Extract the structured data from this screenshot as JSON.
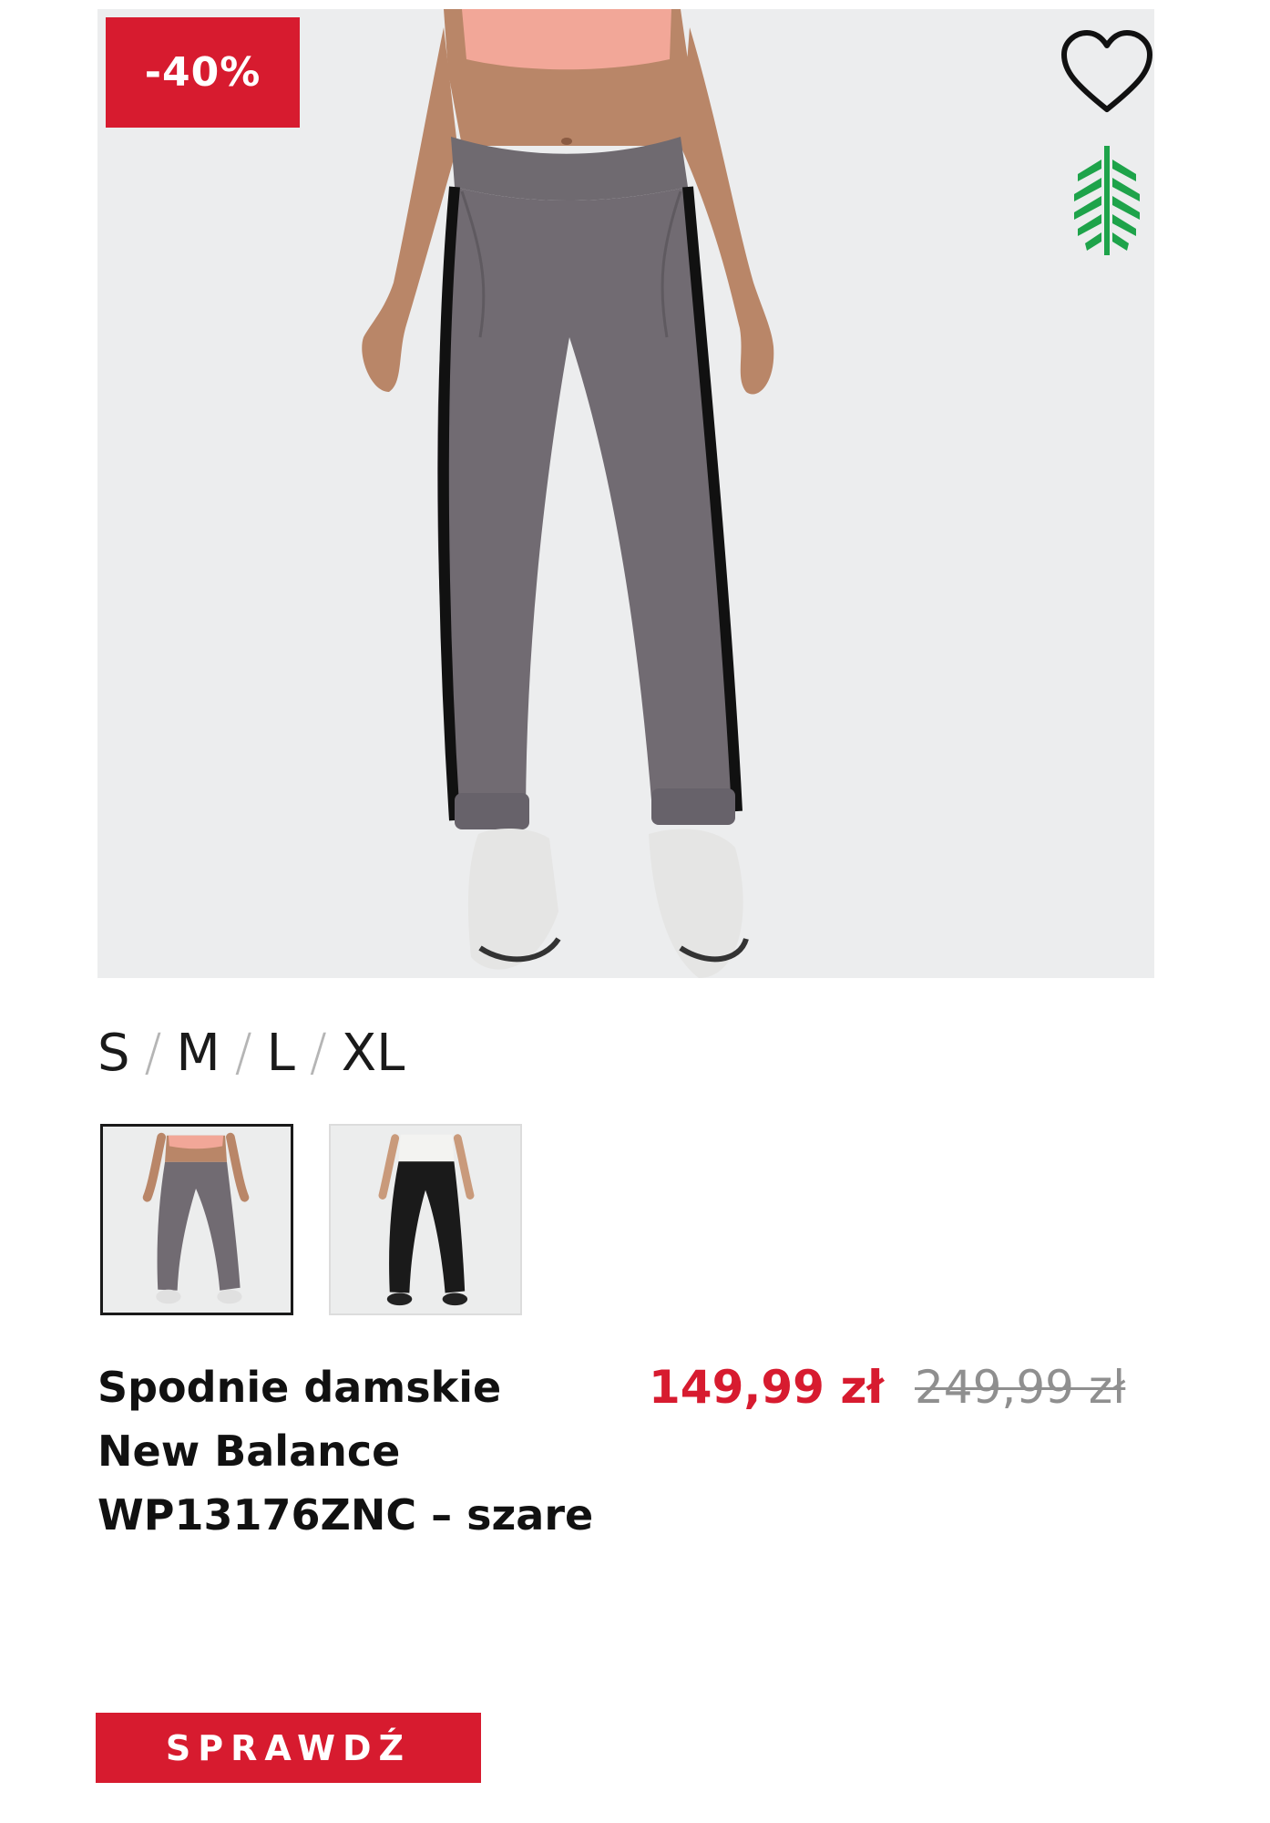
{
  "product": {
    "discount_badge": "-40%",
    "sizes": [
      "S",
      "M",
      "L",
      "XL"
    ],
    "size_separator": "/",
    "title": "Spodnie damskie\nNew Balance\nWP13176ZNC – szare",
    "price_current": "149,99 zł",
    "price_old": "249,99 zł",
    "cta_label": "SPRAWDŹ",
    "thumbnails": [
      {
        "variant": "grey-pants",
        "selected": true
      },
      {
        "variant": "black-pants",
        "selected": false
      }
    ]
  },
  "icons": {
    "wishlist": "heart-outline-icon",
    "eco": "leaf-icon"
  },
  "colors": {
    "accent_red": "#d71b2f",
    "old_price_grey": "#8f8f8f",
    "eco_green": "#1ea34a",
    "image_background": "#ecedee"
  }
}
